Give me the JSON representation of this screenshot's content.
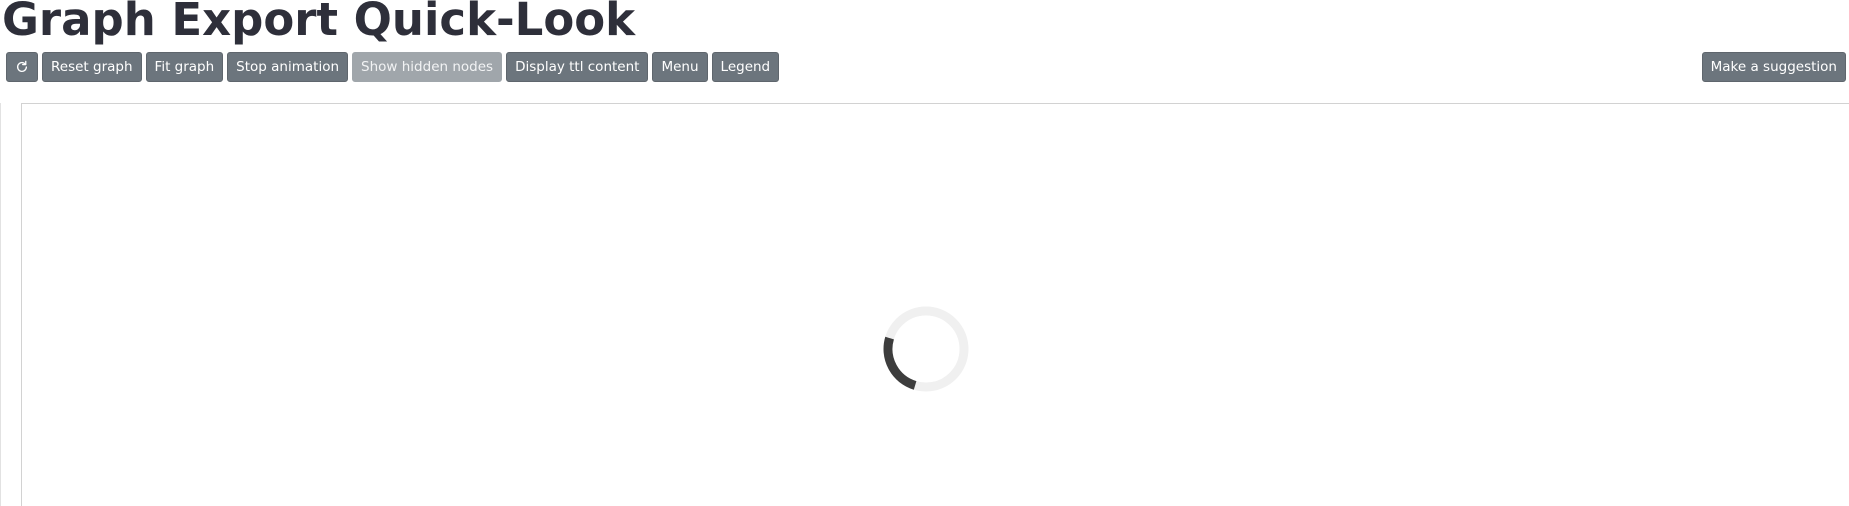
{
  "page": {
    "title": "Graph Export Quick-Look"
  },
  "toolbar": {
    "refresh_icon": "refresh-icon",
    "reset_label": "Reset graph",
    "fit_label": "Fit graph",
    "stop_animation_label": "Stop animation",
    "show_hidden_label": "Show hidden nodes",
    "display_ttl_label": "Display ttl content",
    "menu_label": "Menu",
    "legend_label": "Legend"
  },
  "suggestion": {
    "label": "Make a suggestion"
  },
  "graph": {
    "loading_indicator": "loading-spinner"
  },
  "colors": {
    "button": "#6c757d",
    "button_disabled": "#a0a6ab",
    "title": "#2e2f3a",
    "spinner_track": "#f0f0f0",
    "spinner_arc": "#3d3d3d"
  }
}
